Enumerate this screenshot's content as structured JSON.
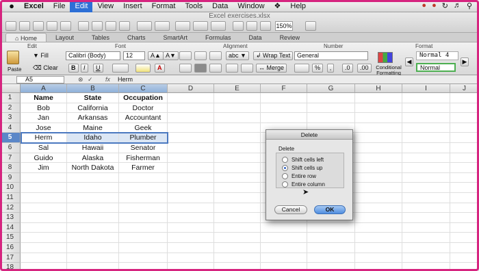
{
  "menubar": {
    "apple": "",
    "items": [
      "Excel",
      "File",
      "Edit",
      "View",
      "Insert",
      "Format",
      "Tools",
      "Data",
      "Window",
      "Help"
    ],
    "active_index": 2
  },
  "toolbar": {
    "doc_title": "Excel exercises.xlsx",
    "zoom": "150%"
  },
  "ribbon_tabs": [
    "Home",
    "Layout",
    "Tables",
    "Charts",
    "SmartArt",
    "Formulas",
    "Data",
    "Review"
  ],
  "ribbon": {
    "groups": {
      "edit": "Edit",
      "font": "Font",
      "alignment": "Alignment",
      "number": "Number",
      "format": "Format"
    },
    "paste": "Paste",
    "fill": "Fill",
    "clear": "Clear",
    "font_name": "Calibri (Body)",
    "font_size": "12",
    "wrap_text": "Wrap Text",
    "merge": "Merge",
    "number_format": "General",
    "conditional_formatting": "Conditional Formatting",
    "style_normal4": "Normal 4",
    "style_normal": "Normal",
    "abc": "abc"
  },
  "formula_bar": {
    "cell_ref": "A5",
    "value": "Herm",
    "fx": "fx"
  },
  "sheet": {
    "columns": [
      "A",
      "B",
      "C",
      "D",
      "E",
      "F",
      "G",
      "H",
      "I",
      "J"
    ],
    "row_numbers": [
      "1",
      "2",
      "3",
      "4",
      "5",
      "6",
      "7",
      "8",
      "9",
      "10",
      "11",
      "12",
      "13",
      "14",
      "15",
      "16",
      "17",
      "18"
    ],
    "selected_row": "5",
    "headers": [
      "Name",
      "State",
      "Occupation"
    ],
    "rows": [
      [
        "Bob",
        "California",
        "Doctor"
      ],
      [
        "Jan",
        "Arkansas",
        "Accountant"
      ],
      [
        "Jose",
        "Maine",
        "Geek"
      ],
      [
        "Herm",
        "Idaho",
        "Plumber"
      ],
      [
        "Sal",
        "Hawaii",
        "Senator"
      ],
      [
        "Guido",
        "Alaska",
        "Fisherman"
      ],
      [
        "Jim",
        "North Dakota",
        "Farmer"
      ]
    ]
  },
  "dialog": {
    "title": "Delete",
    "group_label": "Delete",
    "options": [
      "Shift cells left",
      "Shift cells up",
      "Entire row",
      "Entire column"
    ],
    "selected_option": 1,
    "cancel": "Cancel",
    "ok": "OK"
  }
}
